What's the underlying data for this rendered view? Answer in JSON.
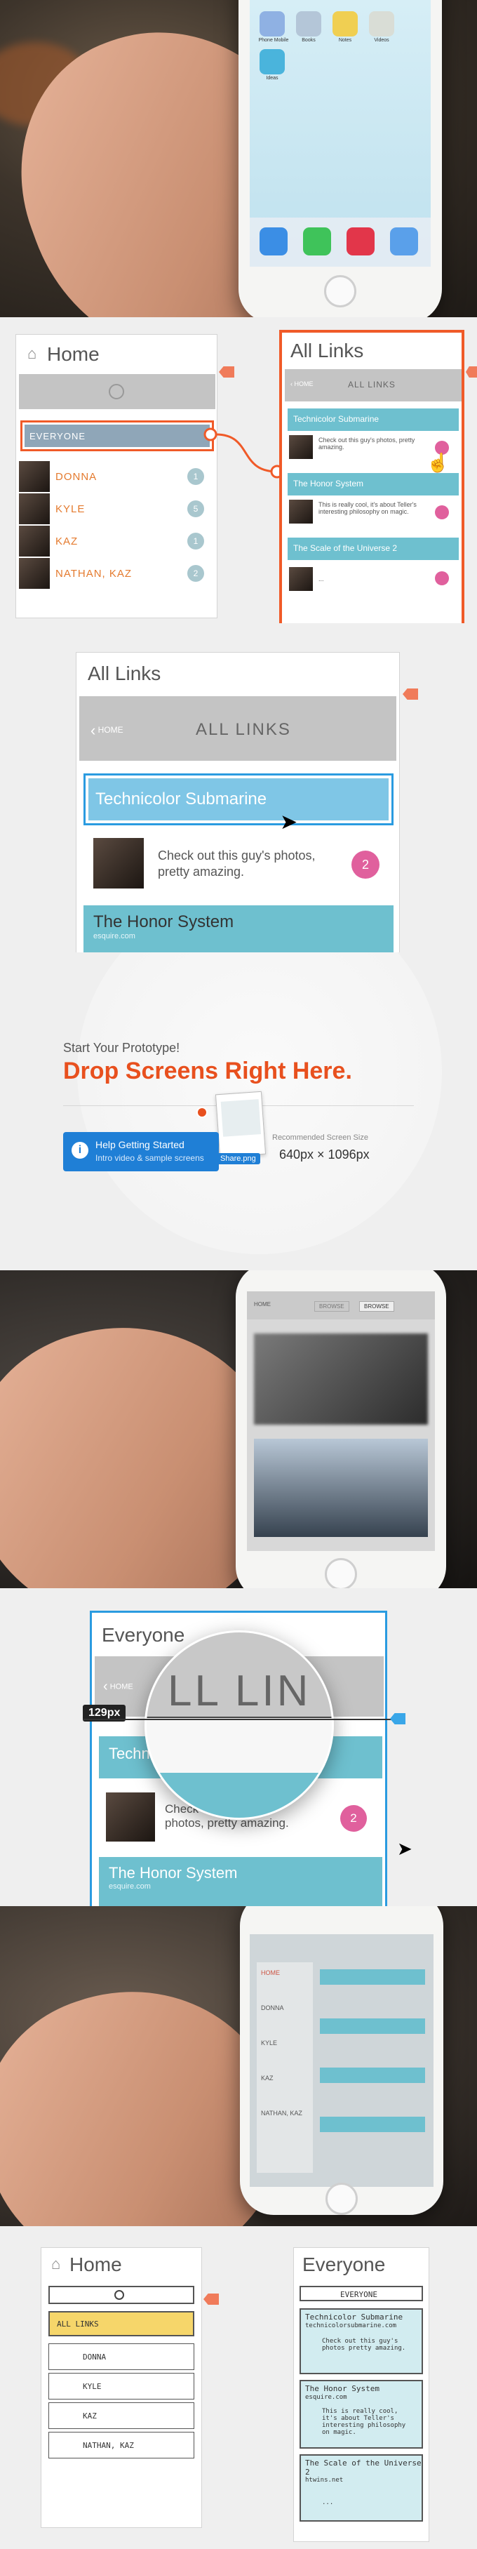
{
  "panel1": {
    "apps": [
      "Phone Mobile",
      "Books",
      "Notes",
      "Videos"
    ],
    "app_below": "Ideas",
    "dock_icons": [
      "compass-icon",
      "phone-icon",
      "music-icon",
      "mail-icon"
    ],
    "colors": {
      "orange": "#f07b5a"
    }
  },
  "panel2": {
    "home_title": "Home",
    "everyone_label": "EVERYONE",
    "contacts": [
      {
        "name": "DONNA",
        "badge": "1"
      },
      {
        "name": "KYLE",
        "badge": "5"
      },
      {
        "name": "KAZ",
        "badge": "1"
      },
      {
        "name": "NATHAN, KAZ",
        "badge": "2"
      }
    ],
    "all_links_title": "All Links",
    "nav_back": "HOME",
    "nav_title": "ALL LINKS",
    "links": [
      {
        "title": "Technicolor Submarine",
        "text": "Check out this guy's photos, pretty amazing."
      },
      {
        "title": "The Honor System",
        "text": "This is really cool, it's about Teller's interesting philosophy on magic."
      },
      {
        "title": "The Scale of the Universe 2",
        "text": "..."
      }
    ]
  },
  "panel3": {
    "title": "All Links",
    "nav_back": "HOME",
    "nav_title": "ALL LINKS",
    "link1_title": "Technicolor Submarine",
    "link1_text": "Check out this guy's photos, pretty amazing.",
    "link1_badge": "2",
    "link2_title": "The Honor System",
    "link2_sub": "esquire.com"
  },
  "panel4": {
    "small_heading": "Start Your Prototype!",
    "big_heading": "Drop Screens Right Here.",
    "drag_file": "Share.png",
    "help_title": "Help Getting Started",
    "help_sub": "Intro video & sample screens",
    "rec_label": "Recommended Screen Size",
    "rec_value": "640px × 1096px",
    "colors": {
      "accent": "#e8501e",
      "blue": "#1f7fd6"
    }
  },
  "panel5": {
    "back": "HOME",
    "tab1": "BROWSE",
    "tab2": "BROWSE"
  },
  "panel6": {
    "title": "Everyone",
    "ruler_value": "129px",
    "magnifier_text": "LL LIN",
    "nav_back": "HOME",
    "link1_title": "Technicolor Submarine",
    "link1_text": "Check out this guy's photos, pretty amazing.",
    "link1_badge": "2",
    "link2_title": "The Honor System",
    "link2_sub": "esquire.com",
    "colors": {
      "selection": "#2a9be0"
    }
  },
  "panel7": {
    "overlay_labels": [
      "HOME",
      "DONNA",
      "KYLE",
      "KAZ",
      "NATHAN, KAZ"
    ]
  },
  "panel8": {
    "home_title": "Home",
    "all_links": "ALL LINKS",
    "contacts": [
      "DONNA",
      "KYLE",
      "KAZ",
      "NATHAN, KAZ"
    ],
    "everyone_title": "Everyone",
    "everyone_nav": "EVERYONE",
    "sketch_links": [
      {
        "title": "Technicolor Submarine",
        "sub": "technicolorsubmarine.com",
        "text": "Check out this guy's photos pretty amazing."
      },
      {
        "title": "The Honor System",
        "sub": "esquire.com",
        "text": "This is really cool, it's about Teller's interesting philosophy on magic."
      },
      {
        "title": "The Scale of the Universe 2",
        "sub": "htwins.net",
        "text": "..."
      }
    ]
  }
}
